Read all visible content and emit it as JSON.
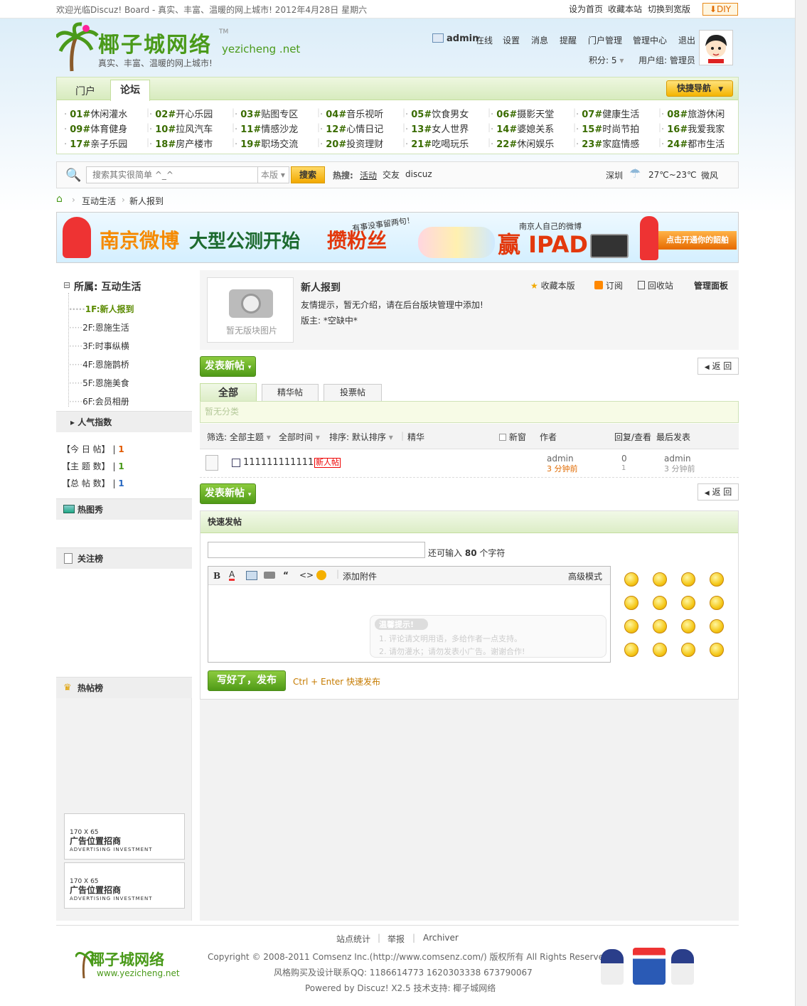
{
  "topbar": {
    "welcome": "欢迎光临Discuz! Board - 真实、丰富、温暖的网上城市!  2012年4月28日 星期六",
    "links": [
      "设为首页",
      "收藏本站",
      "切换到宽版"
    ],
    "diy": "DIY"
  },
  "brand": {
    "logo_cn": "椰子城网络",
    "logo_tm": "TM",
    "logo_en": "yezicheng .net",
    "slogan": "真实、丰富、温暖的网上城市!"
  },
  "user": {
    "name": "admin",
    "status": "在线",
    "links": [
      "设置",
      "消息",
      "提醒",
      "门户管理",
      "管理中心",
      "退出"
    ],
    "credits": "积分: 5",
    "group": "用户组: 管理员"
  },
  "nav": {
    "tabs": [
      "门户",
      "论坛"
    ],
    "quick": "快捷导航",
    "forums": [
      [
        "01#",
        "休闲灌水"
      ],
      [
        "02#",
        "开心乐园"
      ],
      [
        "03#",
        "贴图专区"
      ],
      [
        "04#",
        "音乐视听"
      ],
      [
        "05#",
        "饮食男女"
      ],
      [
        "06#",
        "摄影天堂"
      ],
      [
        "07#",
        "健康生活"
      ],
      [
        "08#",
        "旅游休闲"
      ],
      [
        "09#",
        "体育健身"
      ],
      [
        "10#",
        "拉风汽车"
      ],
      [
        "11#",
        "情感沙龙"
      ],
      [
        "12#",
        "心情日记"
      ],
      [
        "13#",
        "女人世界"
      ],
      [
        "14#",
        "婆媳关系"
      ],
      [
        "15#",
        "时尚节拍"
      ],
      [
        "16#",
        "我爱我家"
      ],
      [
        "17#",
        "亲子乐园"
      ],
      [
        "18#",
        "房产楼市"
      ],
      [
        "19#",
        "职场交流"
      ],
      [
        "20#",
        "投资理财"
      ],
      [
        "21#",
        "吃喝玩乐"
      ],
      [
        "22#",
        "休闲娱乐"
      ],
      [
        "23#",
        "家庭情感"
      ],
      [
        "24#",
        "都市生活"
      ]
    ]
  },
  "search": {
    "placeholder": "搜索其实很简单 ^_^",
    "scope": "本版",
    "button": "搜索",
    "hot_label": "热搜:",
    "hot": [
      "活动",
      "交友",
      "discuz"
    ],
    "city": "深圳",
    "temp": "27℃~23℃",
    "wind": "微风"
  },
  "breadcrumb": [
    "互动生活",
    "新人报到"
  ],
  "banner": {
    "text1": "南京微博",
    "text2": "大型公测开始",
    "text3": "攒粉丝",
    "text4": "赢 IPAD",
    "bubble": "有事没事留两句！",
    "tag": "南京人自己的微博",
    "cta": "点击开通你的韶舶"
  },
  "sidebar": {
    "group": "所属: 互动生活",
    "items": [
      "1F:新人报到",
      "2F:恩施生活",
      "3F:时事纵横",
      "4F:恩施鹊桥",
      "5F:恩施美食",
      "6F:会员相册"
    ],
    "stats_title": "人气指数",
    "stats": [
      {
        "label": "【今 日 帖】",
        "value": "1"
      },
      {
        "label": "【主 题 数】",
        "value": "1"
      },
      {
        "label": "【总 帖 数】",
        "value": "1"
      }
    ],
    "hot_pic": "热图秀",
    "follow": "关注榜",
    "hot_threads": "热帖榜",
    "ads": [
      {
        "size": "170 X 65",
        "title": "广告位置招商",
        "sub": "ADVERTISING INVESTMENT"
      },
      {
        "size": "170 X 65",
        "title": "广告位置招商",
        "sub": "ADVERTISING INVESTMENT"
      }
    ]
  },
  "forum": {
    "noimg": "暂无版块图片",
    "title": "新人报到",
    "fav": "收藏本版",
    "rss": "订阅",
    "trash": "回收站",
    "panel": "管理面板",
    "desc": "友情提示，暂无介绍，请在后台版块管理中添加!",
    "mod": "版主: *空缺中*"
  },
  "actions": {
    "post": "发表新帖",
    "back": "返 回"
  },
  "tabs": [
    "全部",
    "精华帖",
    "投票帖"
  ],
  "nocat": "暂无分类",
  "filter": {
    "filter": "筛选: 全部主题",
    "time": "全部时间",
    "sort": "排序: 默认排序",
    "digest": "精华",
    "newwin": "新窗",
    "author": "作者",
    "reply": "回复/查看",
    "last": "最后发表"
  },
  "threads": [
    {
      "title": "111111111111",
      "badge": "新人帖",
      "author": "admin",
      "author_time": "3 分钟前",
      "replies": "0",
      "views": "1",
      "last": "admin",
      "last_time": "3 分钟前"
    }
  ],
  "quickpost": {
    "title": "快速发帖",
    "remain": "还可输入",
    "count": "80",
    "unit": "个字符",
    "attach": "添加附件",
    "advanced": "高级模式",
    "tip_title": "温馨提示!",
    "tips": [
      "1. 评论请文明用语，多给作者一点支持。",
      "2. 请勿灌水；请勿发表小广告。谢谢合作!"
    ],
    "submit": "写好了，发布",
    "hint": "Ctrl + Enter 快速发布"
  },
  "footer": {
    "links": [
      "站点统计",
      "举报",
      "Archiver"
    ],
    "copyright": "Copyright © 2008-2011 Comsenz Inc.(http://www.comsenz.com/) 版权所有  All Rights Reserved.",
    "contact": "风格购买及设计联系QQ: 1186614773 1620303338 673790067",
    "powered": "Powered by Discuz! X2.5  技术支持: 椰子城网络",
    "logo_cn": "椰子城网络",
    "logo_en": "www.yezicheng.net"
  }
}
